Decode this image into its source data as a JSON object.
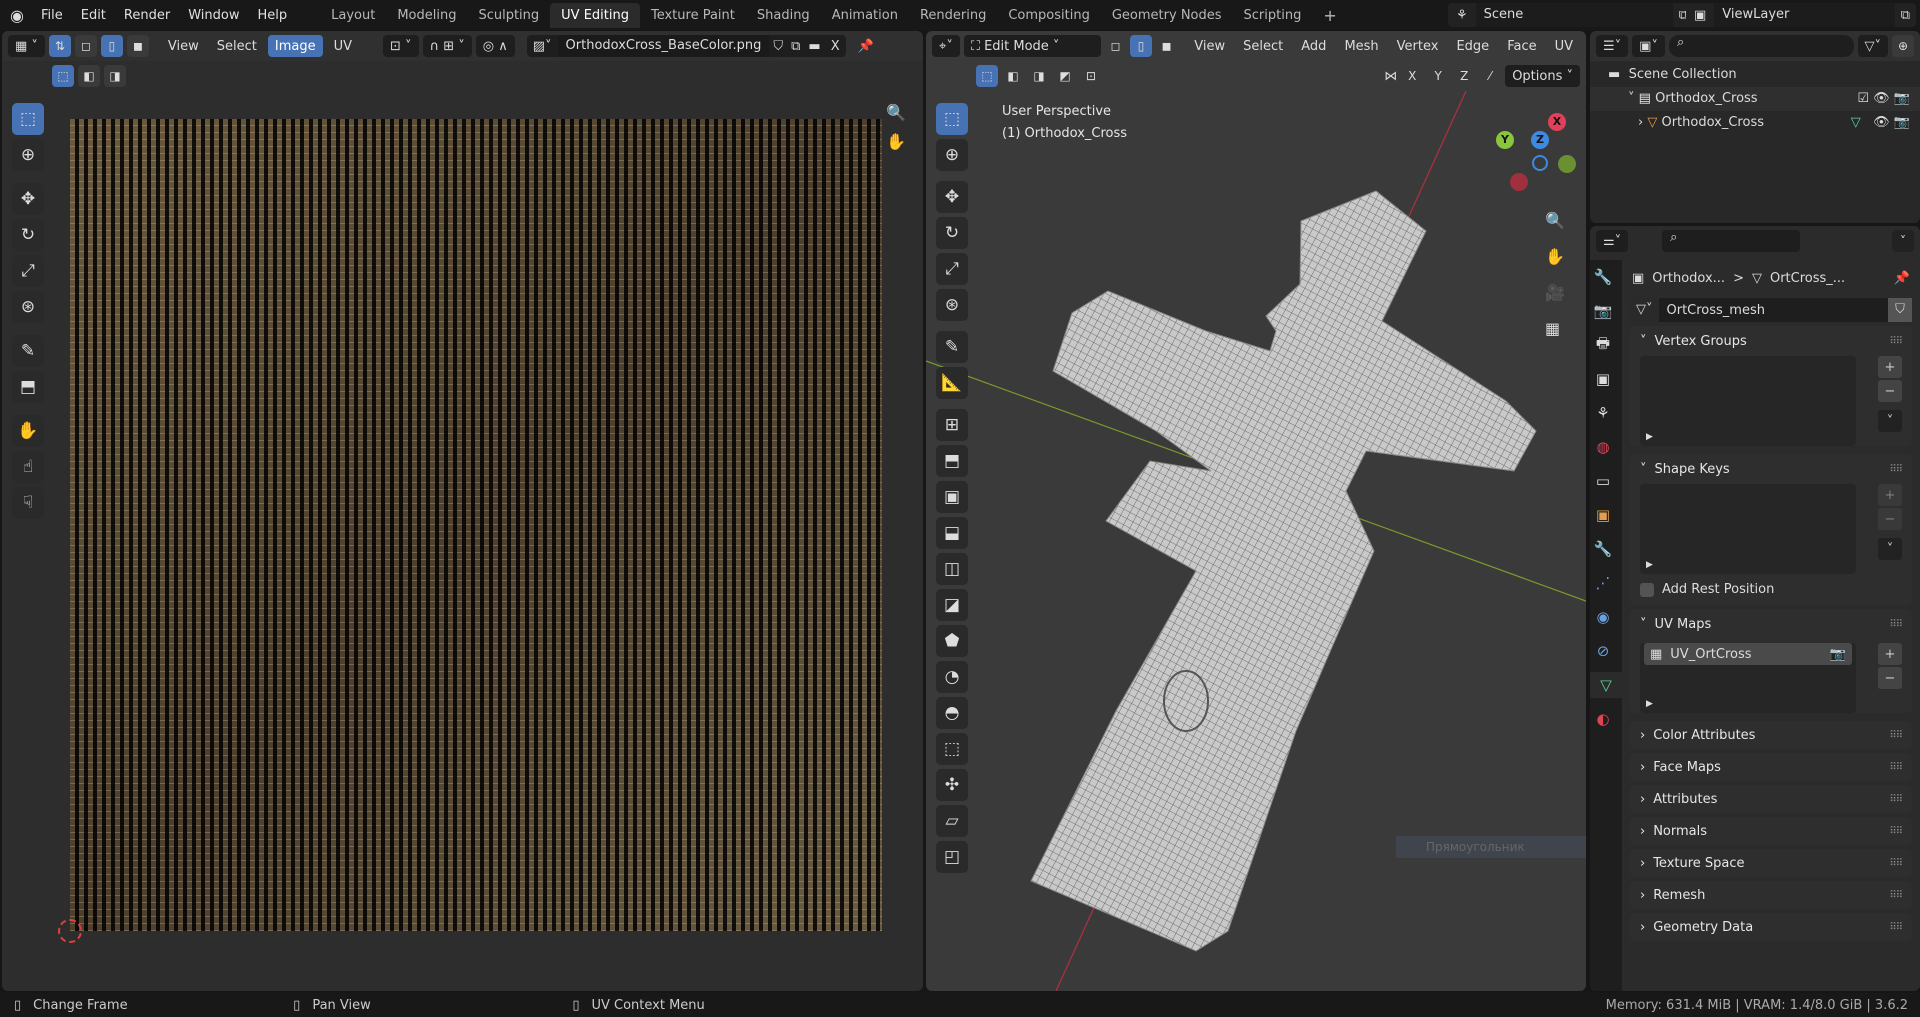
{
  "topbar": {
    "menus": [
      "File",
      "Edit",
      "Render",
      "Window",
      "Help"
    ],
    "workspaces": [
      "Layout",
      "Modeling",
      "Sculpting",
      "UV Editing",
      "Texture Paint",
      "Shading",
      "Animation",
      "Rendering",
      "Compositing",
      "Geometry Nodes",
      "Scripting"
    ],
    "active_workspace": "UV Editing",
    "add_tab": "+",
    "scene": "Scene",
    "view_layer": "ViewLayer"
  },
  "uv_editor": {
    "menus": [
      "View",
      "Select",
      "Image",
      "UV"
    ],
    "active_menu": "Image",
    "image_name": "OrthodoxCross_BaseColor.png",
    "close": "X"
  },
  "viewport": {
    "mode": "Edit Mode",
    "menus": [
      "View",
      "Select",
      "Add",
      "Mesh",
      "Vertex",
      "Edge",
      "Face",
      "UV"
    ],
    "axes": [
      "X",
      "Y",
      "Z"
    ],
    "options": "Options",
    "perspective": "User Perspective",
    "object_label": "(1) Orthodox_Cross",
    "gizmo": {
      "x": "X",
      "y": "Y",
      "z": "Z"
    },
    "overlay_hint": "Прямоугольник"
  },
  "outliner": {
    "root": "Scene Collection",
    "collection": "Orthodox_Cross",
    "object": "Orthodox_Cross"
  },
  "properties": {
    "breadcrumb_object": "Orthodox...",
    "breadcrumb_sep": ">",
    "breadcrumb_mesh": "OrtCross_...",
    "mesh_name": "OrtCross_mesh",
    "panels": {
      "vertex_groups": "Vertex Groups",
      "shape_keys": "Shape Keys",
      "add_rest_position": "Add Rest Position",
      "uv_maps": "UV Maps",
      "uv_map_item": "UV_OrtCross"
    },
    "collapsed": [
      "Color Attributes",
      "Face Maps",
      "Attributes",
      "Normals",
      "Texture Space",
      "Remesh",
      "Geometry Data"
    ]
  },
  "status": {
    "left": "Change Frame",
    "middle": "Pan View",
    "right": "UV Context Menu",
    "info": "Memory: 631.4 MiB | VRAM: 1.4/8.0 GiB | 3.6.2"
  }
}
